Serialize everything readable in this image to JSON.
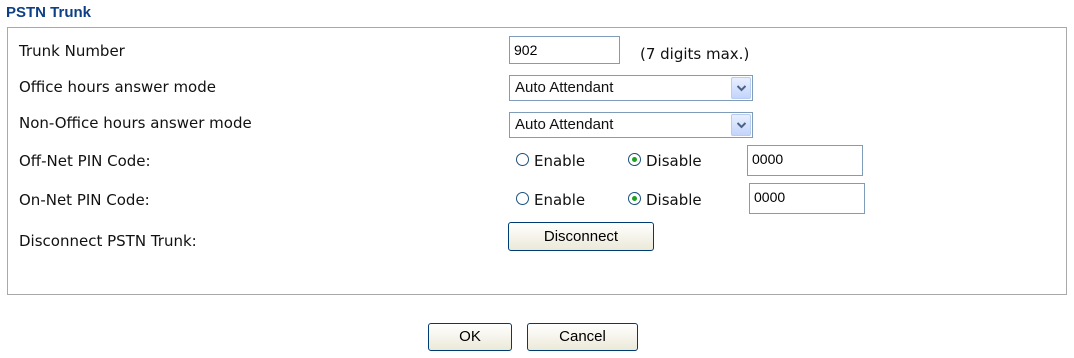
{
  "section_title": "PSTN Trunk",
  "rows": {
    "trunk_number": {
      "label": "Trunk Number",
      "value": "902",
      "hint": "(7 digits max.)"
    },
    "office_hours": {
      "label": "Office hours answer mode",
      "selected": "Auto Attendant"
    },
    "non_office_hours": {
      "label": "Non-Office hours answer mode",
      "selected": "Auto Attendant"
    },
    "off_net_pin": {
      "label": "Off-Net PIN Code:",
      "enable_label": "Enable",
      "disable_label": "Disable",
      "selected": "Disable",
      "value": "0000"
    },
    "on_net_pin": {
      "label": "On-Net PIN Code:",
      "enable_label": "Enable",
      "disable_label": "Disable",
      "selected": "Disable",
      "value": "0000"
    },
    "disconnect": {
      "label": "Disconnect PSTN Trunk:",
      "button_label": "Disconnect"
    }
  },
  "footer": {
    "ok_label": "OK",
    "cancel_label": "Cancel"
  },
  "colors": {
    "title": "#0d3f86",
    "border": "#a9a9a9",
    "radio_dot": "#21a121"
  }
}
